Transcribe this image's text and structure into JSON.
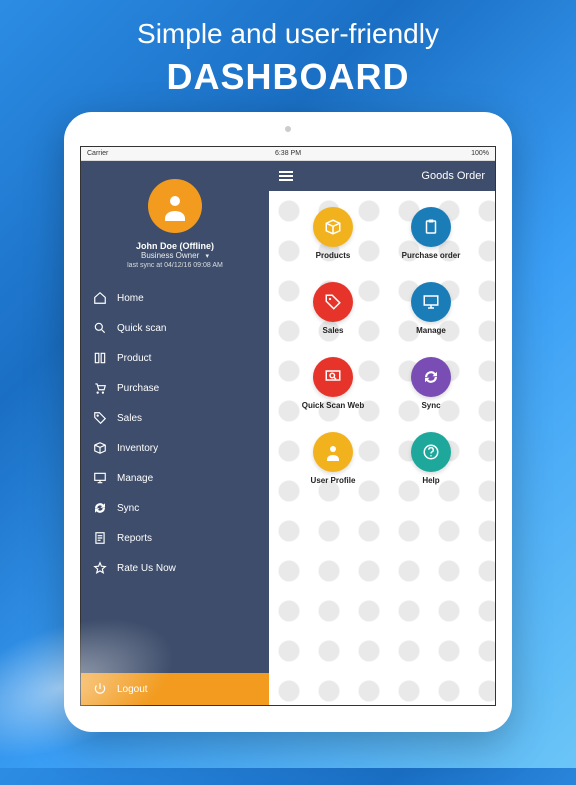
{
  "promo": {
    "line1": "Simple and user-friendly",
    "line2": "DASHBOARD"
  },
  "status": {
    "carrier": "Carrier",
    "time": "6:38 PM",
    "battery": "100%"
  },
  "profile": {
    "name": "John  Doe (Offline)",
    "role": "Business Owner",
    "sync": "last sync at 04/12/16 09:08 AM"
  },
  "menu": [
    {
      "label": "Home",
      "icon": "home"
    },
    {
      "label": "Quick scan",
      "icon": "search"
    },
    {
      "label": "Product",
      "icon": "book"
    },
    {
      "label": "Purchase",
      "icon": "cart"
    },
    {
      "label": "Sales",
      "icon": "tag"
    },
    {
      "label": "Inventory",
      "icon": "box"
    },
    {
      "label": "Manage",
      "icon": "monitor"
    },
    {
      "label": "Sync",
      "icon": "sync"
    },
    {
      "label": "Reports",
      "icon": "report"
    },
    {
      "label": "Rate Us Now",
      "icon": "star"
    }
  ],
  "logout": {
    "label": "Logout"
  },
  "topbar": {
    "title": "Goods Order"
  },
  "cards": [
    {
      "label": "Products",
      "icon": "box",
      "color": "#f2b21e"
    },
    {
      "label": "Purchase order",
      "icon": "clipboard",
      "color": "#1a7db8"
    },
    {
      "label": "Sales",
      "icon": "tag",
      "color": "#e6342a"
    },
    {
      "label": "Manage",
      "icon": "monitor",
      "color": "#1a7db8"
    },
    {
      "label": "Quick Scan Web",
      "icon": "screen-search",
      "color": "#e6342a"
    },
    {
      "label": "Sync",
      "icon": "sync",
      "color": "#7a4db5"
    },
    {
      "label": "User Profile",
      "icon": "person",
      "color": "#f2b21e"
    },
    {
      "label": "Help",
      "icon": "help",
      "color": "#1ea89c"
    }
  ]
}
